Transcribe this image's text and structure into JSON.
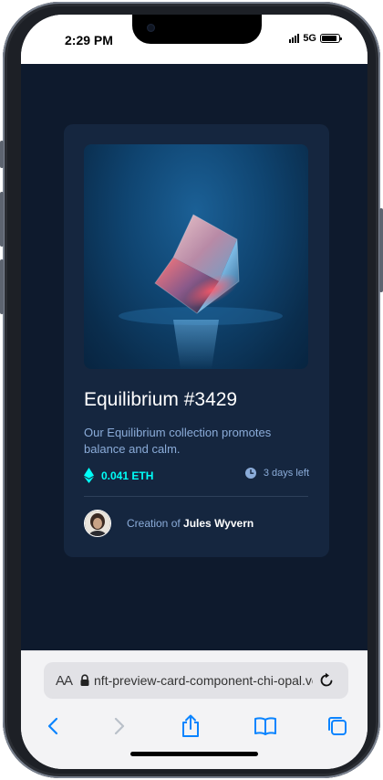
{
  "status_bar": {
    "time": "2:29 PM",
    "network": "5G"
  },
  "card": {
    "image_alt": "equilibrium-cube-image",
    "title": "Equilibrium #3429",
    "description": "Our Equilibrium collection promotes balance and calm.",
    "price": "0.041 ETH",
    "time_left": "3 days left",
    "creator_prefix": "Creation of",
    "creator_name": "Jules Wyvern"
  },
  "browser": {
    "text_size_label": "AA",
    "url": "nft-preview-card-component-chi-opal.vercel.app"
  },
  "colors": {
    "page_bg": "#0e1a2d",
    "card_bg": "#15263f",
    "cyan": "#00fff8",
    "soft_blue": "#8bacd9",
    "safari_blue": "#0a84ff"
  },
  "icons": {
    "ethereum": "ethereum-icon",
    "clock": "clock-icon",
    "lock": "lock-icon",
    "reload": "reload-icon",
    "back": "back-chevron-icon",
    "forward": "forward-chevron-icon",
    "share": "share-icon",
    "bookmarks": "bookmarks-book-icon",
    "tabs": "tabs-icon"
  }
}
